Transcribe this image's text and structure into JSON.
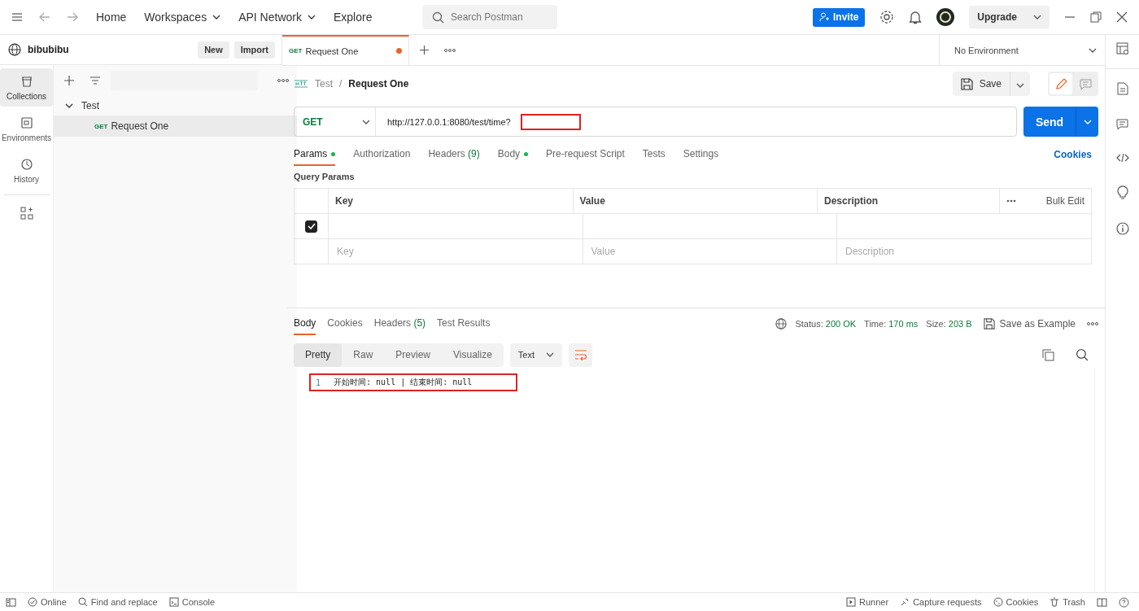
{
  "topbar": {
    "nav": [
      {
        "label": "Home",
        "dropdown": false
      },
      {
        "label": "Workspaces",
        "dropdown": true
      },
      {
        "label": "API Network",
        "dropdown": true
      },
      {
        "label": "Explore",
        "dropdown": false
      }
    ],
    "search": {
      "placeholder": "Search Postman"
    },
    "invite": "Invite",
    "upgrade": "Upgrade"
  },
  "workspace": {
    "name": "bibubibu",
    "buttons": [
      "New",
      "Import"
    ]
  },
  "rail": [
    {
      "label": "Collections",
      "selected": true
    },
    {
      "label": "Environments",
      "selected": false
    },
    {
      "label": "History",
      "selected": false
    }
  ],
  "tree": [
    {
      "label": "Test",
      "expanded": true,
      "children": [
        {
          "method": "GET",
          "label": "Request One",
          "selected": true
        }
      ]
    }
  ],
  "tabs": [
    {
      "method": "GET",
      "label": "Request One",
      "unsaved": true,
      "selected": true
    }
  ],
  "environment": "No Environment",
  "breadcrumb": {
    "parent": "Test",
    "separator": "/",
    "current": "Request One"
  },
  "save": "Save",
  "request": {
    "method": "GET",
    "url": "http://127.0.0.1:8080/test/time?",
    "send": "Send"
  },
  "request_tabs": [
    {
      "label": "Params",
      "dot": true,
      "selected": true
    },
    {
      "label": "Authorization",
      "dot": false,
      "selected": false
    },
    {
      "label": "Headers",
      "count": "(9)",
      "dot": false,
      "selected": false
    },
    {
      "label": "Body",
      "dot": true,
      "selected": false
    },
    {
      "label": "Pre-request Script",
      "dot": false,
      "selected": false
    },
    {
      "label": "Tests",
      "dot": false,
      "selected": false
    },
    {
      "label": "Settings",
      "dot": false,
      "selected": false
    }
  ],
  "cookies_link": "Cookies",
  "query_params": {
    "title": "Query Params",
    "columns": [
      "Key",
      "Value",
      "Description"
    ],
    "bulk_edit": "Bulk Edit",
    "rows": [
      {
        "checked": true
      }
    ],
    "placeholders": [
      "Key",
      "Value",
      "Description"
    ]
  },
  "response_tabs": [
    {
      "label": "Body",
      "selected": true
    },
    {
      "label": "Cookies",
      "selected": false
    },
    {
      "label": "Headers",
      "count": "(5)",
      "selected": false
    },
    {
      "label": "Test Results",
      "selected": false
    }
  ],
  "response_meta": [
    {
      "label": "Status:",
      "value": "200 OK"
    },
    {
      "label": "Time:",
      "value": "170 ms"
    },
    {
      "label": "Size:",
      "value": "203 B"
    }
  ],
  "save_example": "Save as Example",
  "view_modes": [
    {
      "label": "Pretty",
      "selected": true
    },
    {
      "label": "Raw",
      "selected": false
    },
    {
      "label": "Preview",
      "selected": false
    },
    {
      "label": "Visualize",
      "selected": false
    }
  ],
  "format": "Text",
  "response_lines": [
    {
      "number": "1",
      "text": "开始时间: null | 结束时间: null"
    }
  ],
  "footer": {
    "left": [
      "Online",
      "Find and replace",
      "Console"
    ],
    "right": [
      "Runner",
      "Capture requests",
      "Cookies",
      "Trash"
    ]
  }
}
